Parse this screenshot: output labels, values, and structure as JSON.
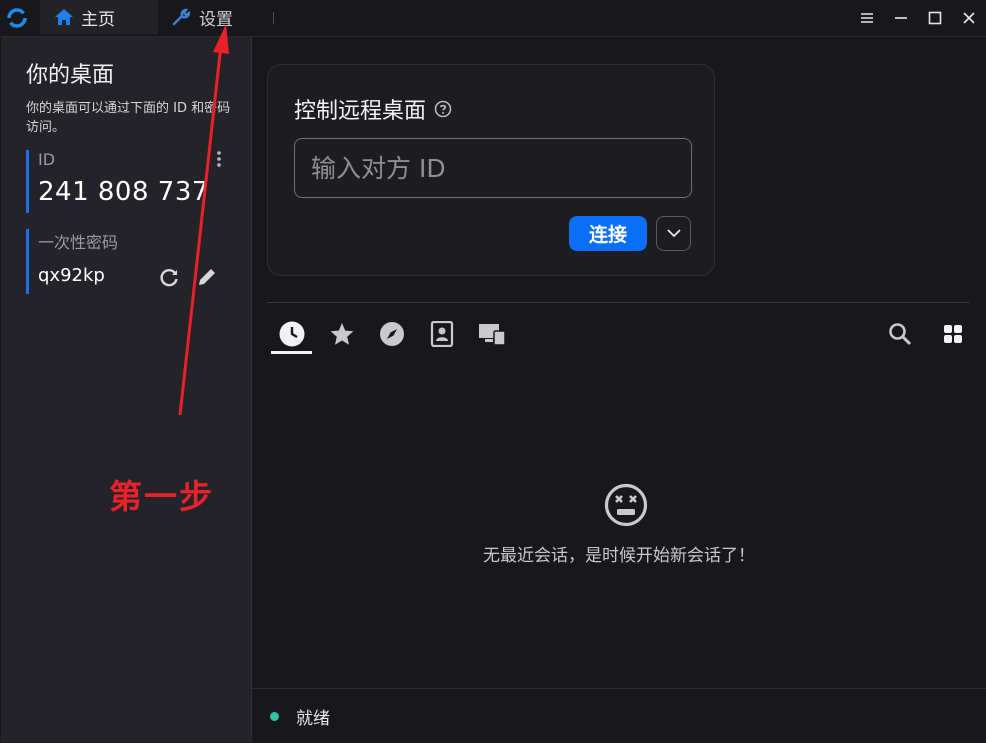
{
  "tabs": {
    "home": "主页",
    "settings": "设置"
  },
  "sidebar": {
    "title": "你的桌面",
    "description": "你的桌面可以通过下面的 ID 和密码访问。",
    "id_label": "ID",
    "id_value": "241 808 737",
    "password_label": "一次性密码",
    "password_value": "qx92kp"
  },
  "control": {
    "title": "控制远程桌面",
    "input_placeholder": "输入对方 ID",
    "input_value": "",
    "connect_label": "连接"
  },
  "sessions": {
    "empty_message": "无最近会话，是时候开始新会话了！",
    "toolbar_icons": [
      "clock-icon",
      "star-icon",
      "compass-icon",
      "address-book-icon",
      "devices-icon",
      "search-icon",
      "grid-view-icon"
    ]
  },
  "status": {
    "text": "就绪",
    "color": "#2ec4a0"
  },
  "annotation": {
    "text": "第一步",
    "color": "#e8212a"
  },
  "colors": {
    "accent": "#0a6ef7",
    "background": "#18181c",
    "sidebar": "#232329"
  }
}
